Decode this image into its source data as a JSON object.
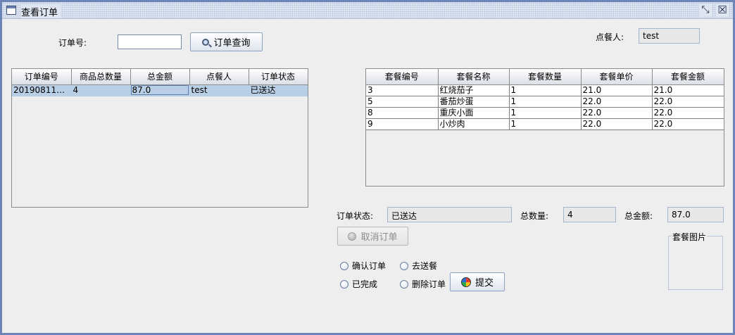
{
  "window": {
    "title": "查看订单",
    "restore_icon": "restore-icon",
    "close_icon": "close-icon"
  },
  "search": {
    "label": "订单号:",
    "value": "",
    "button_label": "订单查询",
    "button_icon": "search-icon"
  },
  "orderer": {
    "label": "点餐人:",
    "value": "test"
  },
  "orders_table": {
    "columns": [
      "订单编号",
      "商品总数量",
      "总金额",
      "点餐人",
      "订单状态"
    ],
    "rows": [
      {
        "cells": [
          "2019081109...",
          "4",
          "87.0",
          "test",
          "已送达"
        ],
        "selected": true
      }
    ]
  },
  "items_table": {
    "columns": [
      "套餐编号",
      "套餐名称",
      "套餐数量",
      "套餐单价",
      "套餐金额"
    ],
    "rows": [
      [
        "3",
        "红烧茄子",
        "1",
        "21.0",
        "21.0"
      ],
      [
        "5",
        "番茄炒蛋",
        "1",
        "22.0",
        "22.0"
      ],
      [
        "8",
        "重庆小面",
        "1",
        "22.0",
        "22.0"
      ],
      [
        "9",
        "小炒肉",
        "1",
        "22.0",
        "22.0"
      ]
    ]
  },
  "status": {
    "label": "订单状态:",
    "value": "已送达"
  },
  "total_qty": {
    "label": "总数量:",
    "value": "4"
  },
  "total_amount": {
    "label": "总金额:",
    "value": "87.0"
  },
  "cancel_button": {
    "label": "取消订单",
    "enabled": false
  },
  "image_panel": {
    "title": "套餐图片"
  },
  "radios": {
    "confirm": "确认订单",
    "deliver": "去送餐",
    "complete": "已完成",
    "delete": "删除订单"
  },
  "submit_button": {
    "label": "提交",
    "icon": "globe-icon"
  }
}
